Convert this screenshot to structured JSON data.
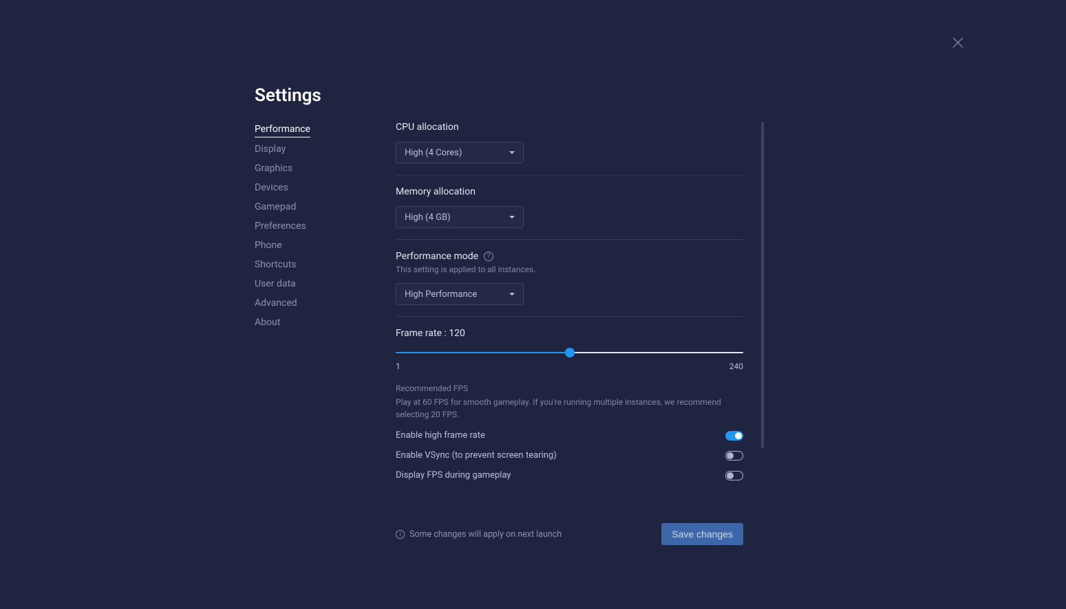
{
  "title": "Settings",
  "sidebar": {
    "items": [
      {
        "label": "Performance",
        "active": true
      },
      {
        "label": "Display",
        "active": false
      },
      {
        "label": "Graphics",
        "active": false
      },
      {
        "label": "Devices",
        "active": false
      },
      {
        "label": "Gamepad",
        "active": false
      },
      {
        "label": "Preferences",
        "active": false
      },
      {
        "label": "Phone",
        "active": false
      },
      {
        "label": "Shortcuts",
        "active": false
      },
      {
        "label": "User data",
        "active": false
      },
      {
        "label": "Advanced",
        "active": false
      },
      {
        "label": "About",
        "active": false
      }
    ]
  },
  "cpu": {
    "label": "CPU allocation",
    "value": "High (4 Cores)"
  },
  "memory": {
    "label": "Memory allocation",
    "value": "High (4 GB)"
  },
  "perfmode": {
    "label": "Performance mode",
    "sublabel": "This setting is applied to all instances.",
    "value": "High Performance"
  },
  "framerate": {
    "label_prefix": "Frame rate : ",
    "value": "120",
    "min": "1",
    "max": "240",
    "rec_title": "Recommended FPS",
    "rec_body": "Play at 60 FPS for smooth gameplay. If you're running multiple instances, we recommend selecting 20 FPS."
  },
  "toggles": {
    "highfps": {
      "label": "Enable high frame rate",
      "on": true
    },
    "vsync": {
      "label": "Enable VSync (to prevent screen tearing)",
      "on": false
    },
    "showfps": {
      "label": "Display FPS during gameplay",
      "on": false
    }
  },
  "footer": {
    "note": "Some changes will apply on next launch",
    "save": "Save changes"
  }
}
